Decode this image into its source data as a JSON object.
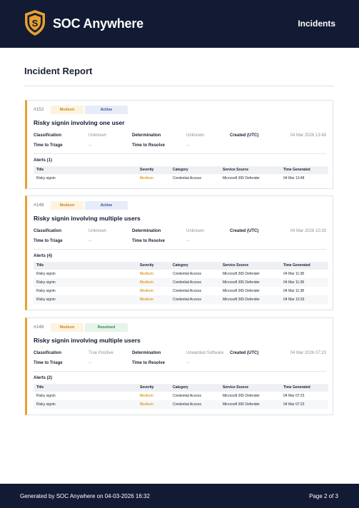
{
  "header": {
    "app_name": "SOC Anywhere",
    "nav_link": "Incidents",
    "logo_letter": "S",
    "brand_color": "#121b33",
    "accent_color": "#e8a030"
  },
  "page_title": "Incident Report",
  "labels": {
    "classification": "Classification",
    "determination": "Determination",
    "created": "Created (UTC)",
    "time_to_triage": "Time to Triage",
    "time_to_resolve": "Time to Resolve"
  },
  "table_headers": [
    "Title",
    "Severity",
    "Category",
    "Service Source",
    "Time Generated"
  ],
  "incidents": [
    {
      "id": "#152",
      "severity": "Medium",
      "status": "Active",
      "title": "Risky signin involving one user",
      "classification": "Unknown",
      "determination": "Unknown",
      "created": "04 Mar 2026 13:48",
      "time_to_triage": "--",
      "time_to_resolve": "--",
      "alerts_label": "Alerts (1)",
      "alerts": [
        [
          "Risky signin",
          "Medium",
          "Credential Access",
          "Microsoft 365 Defender",
          "04 Mar 13:48"
        ]
      ]
    },
    {
      "id": "#148",
      "severity": "Medium",
      "status": "Active",
      "title": "Risky signin involving multiple users",
      "classification": "Unknown",
      "determination": "Unknown",
      "created": "04 Mar 2026 10:33",
      "time_to_triage": "--",
      "time_to_resolve": "--",
      "alerts_label": "Alerts (4)",
      "alerts": [
        [
          "Risky signin",
          "Medium",
          "Credential Access",
          "Microsoft 365 Defender",
          "04 Mar 11:38"
        ],
        [
          "Risky signin",
          "Medium",
          "Credential Access",
          "Microsoft 365 Defender",
          "04 Mar 11:38"
        ],
        [
          "Risky signin",
          "Medium",
          "Credential Access",
          "Microsoft 365 Defender",
          "04 Mar 11:38"
        ],
        [
          "Risky signin",
          "Medium",
          "Credential Access",
          "Microsoft 365 Defender",
          "04 Mar 10:33"
        ]
      ]
    },
    {
      "id": "#146",
      "severity": "Medium",
      "status": "Resolved",
      "title": "Risky signin involving multiple users",
      "classification": "True Positive",
      "determination": "Unwanted Software",
      "created": "04 Mar 2026 07:23",
      "time_to_triage": "--",
      "time_to_resolve": "--",
      "alerts_label": "Alerts (2)",
      "alerts": [
        [
          "Risky signin",
          "Medium",
          "Credential Access",
          "Microsoft 365 Defender",
          "04 Mar 07:23"
        ],
        [
          "Risky signin",
          "Medium",
          "Credential Access",
          "Microsoft 365 Defender",
          "04 Mar 07:23"
        ]
      ]
    }
  ],
  "footer": {
    "generated": "Generated by SOC Anywhere on 04-03-2026 16:32",
    "page": "Page 2 of 3"
  }
}
